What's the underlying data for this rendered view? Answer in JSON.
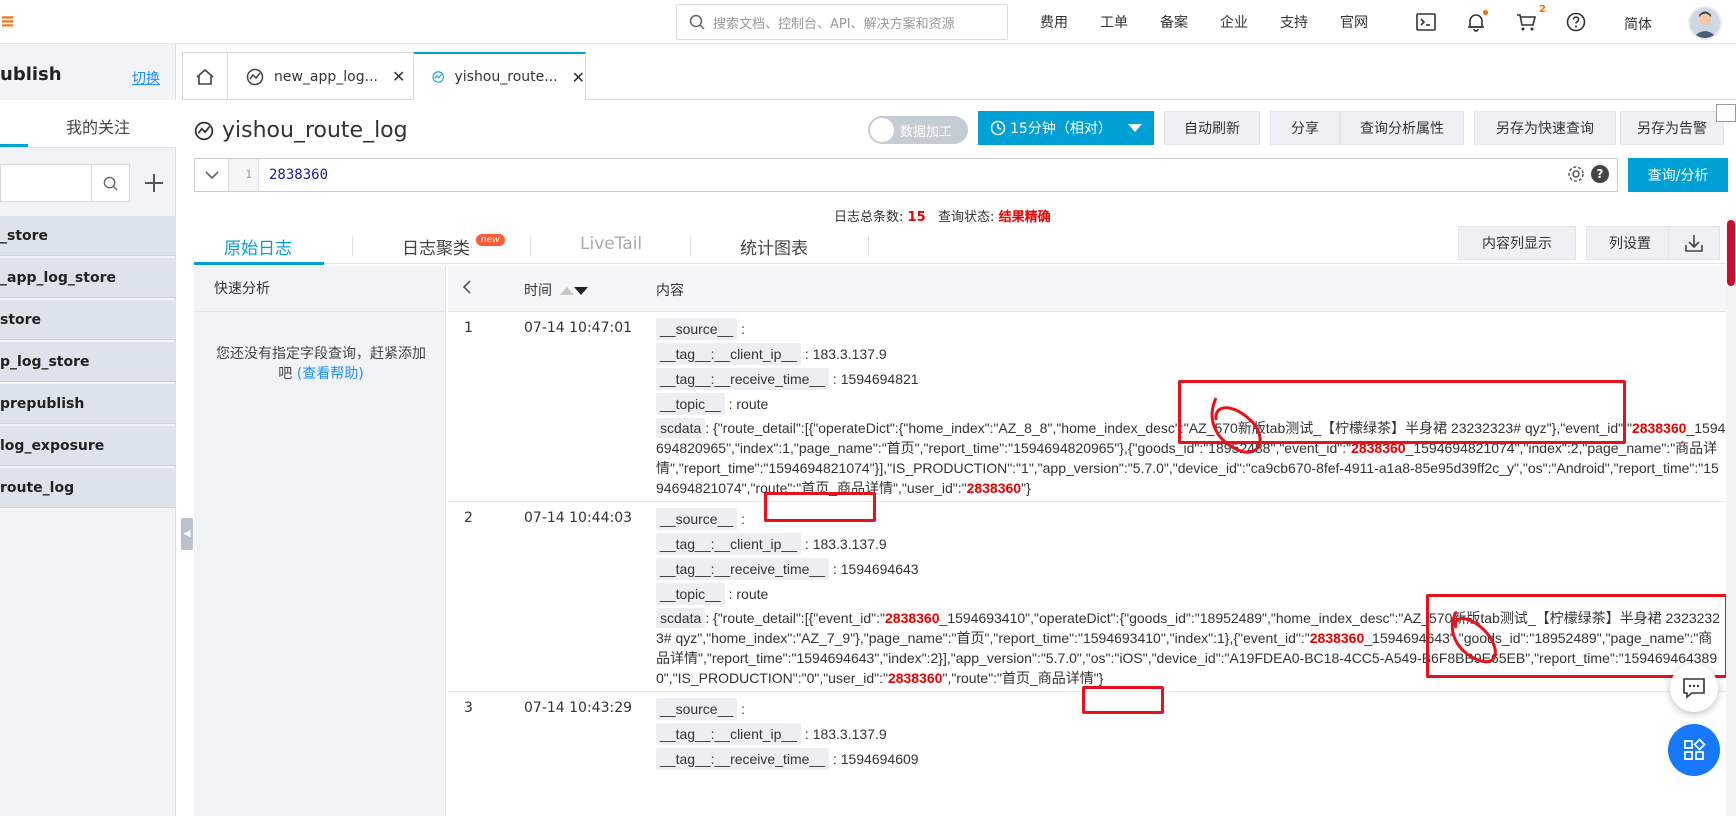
{
  "topbar": {
    "search_placeholder": "搜索文档、控制台、API、解决方案和资源",
    "nav": [
      "费用",
      "工单",
      "备案",
      "企业",
      "支持",
      "官网"
    ],
    "cart_count": "2",
    "language": "简体",
    "icons": [
      "terminal-icon",
      "bell-icon",
      "cart-icon",
      "help-icon"
    ]
  },
  "sidebar": {
    "project_title": "ublish",
    "switch_label": "切换",
    "tab_follow": "我的关注",
    "logstores": [
      "_store",
      "_app_log_store",
      "store",
      "p_log_store",
      "prepublish",
      "log_exposure",
      "route_log"
    ]
  },
  "tabs": [
    {
      "label": "new_app_log..."
    },
    {
      "label": "yishou_route..."
    }
  ],
  "header": {
    "logstore_name": "yishou_route_log",
    "data_process_label": "数据加工",
    "time_range": "15分钟（相对）",
    "buttons": [
      "自动刷新",
      "分享",
      "查询分析属性",
      "另存为快速查询",
      "另存为告警"
    ]
  },
  "query": {
    "line_no": "1",
    "text": "2838360",
    "submit_label": "查询/分析"
  },
  "stats": {
    "total_label": "日志总条数:",
    "total": "15",
    "status_label": "查询状态:",
    "status": "结果精确"
  },
  "result_tabs": {
    "raw": "原始日志",
    "cluster": "日志聚类",
    "new_badge": "new",
    "livetail": "LiveTail",
    "chart": "统计图表"
  },
  "result_buttons": {
    "content_display": "内容列显示",
    "column_settings": "列设置"
  },
  "quick_analysis": {
    "title": "快速分析",
    "message": "您还没有指定字段查询，赶紧添加吧",
    "help_link": "(查看帮助)"
  },
  "table": {
    "col_time": "时间",
    "col_content": "内容",
    "rows": [
      {
        "index": "1",
        "time": "07-14 10:47:01",
        "source_key": "__source__",
        "client_ip_key": "__tag__:__client_ip__",
        "client_ip": "183.3.137.9",
        "receive_time_key": "__tag__:__receive_time__",
        "receive_time": "1594694821",
        "topic_key": "__topic__",
        "topic": "route",
        "scdata_key": "scdata",
        "sc": [
          ":  {\"route_detail\":[{\"operateDict\":{\"home_index\":\"AZ_8_8\",\"home_index_desc\":\"AZ_570新版tab测试_【柠檬绿茶】半身裙  23232323# qyz\"},\"event_id\":\"",
          "2838360",
          "_1594694820965\",\"index\":1,\"page_name\":\"首页\",\"report_time\":\"1594694820965\"},{\"goods_id\":\"18952488\",\"event_id\":\"",
          "2838360",
          "_1594694821074\",\"index\":2,\"page_name\":\"商品详情\",\"report_time\":\"1594694821074\"}],\"IS_PRODUCTION\":\"1\",\"app_version\":\"5.7.0\",\"device_id\":\"ca9cb670-8fef-4911-a1a8-85e95d39ff2c_y\",\"os\":\"Android\",\"report_time\":\"1594694821074\",\"route\":\"首页_商品详情\",\"user_id\":\"",
          "2838360",
          "\"}"
        ]
      },
      {
        "index": "2",
        "time": "07-14 10:44:03",
        "source_key": "__source__",
        "client_ip_key": "__tag__:__client_ip__",
        "client_ip": "183.3.137.9",
        "receive_time_key": "__tag__:__receive_time__",
        "receive_time": "1594694643",
        "topic_key": "__topic__",
        "topic": "route",
        "scdata_key": "scdata",
        "sc": [
          ":  {\"route_detail\":[{\"event_id\":\"",
          "2838360",
          "_1594693410\",\"operateDict\":{\"goods_id\":\"18952489\",\"home_index_desc\":\"AZ_570新版tab测试_【柠檬绿茶】半身裙  23232323#  qyz\",\"home_index\":\"AZ_7_9\"},\"page_name\":\"首页\",\"report_time\":\"1594693410\",\"index\":1},{\"event_id\":\"",
          "2838360",
          "_1594694643\",\"goods_id\":\"18952489\",\"page_name\":\"商品详情\",\"report_time\":\"1594694643\",\"index\":2}],\"app_version\":\"5.7.0\",\"os\":\"iOS\",\"device_id\":\"A19FDEA0-BC18-4CC5-A549-B6F8BB9E65EB\",\"report_time\":\"1594694643890\",\"IS_PRODUCTION\":\"0\",\"user_id\":\"",
          "2838360",
          "\",\"route\":\"首页_商品详情\"}"
        ]
      },
      {
        "index": "3",
        "time": "07-14 10:43:29",
        "source_key": "__source__",
        "client_ip_key": "__tag__:__client_ip__",
        "client_ip": "183.3.137.9",
        "receive_time_key": "__tag__:__receive_time__",
        "receive_time": "1594694609"
      }
    ]
  },
  "colors": {
    "accent": "#00a1d6",
    "highlight": "#e00000",
    "annotation": "#e8101a",
    "sidebar_bg": "#f1f3f6"
  }
}
